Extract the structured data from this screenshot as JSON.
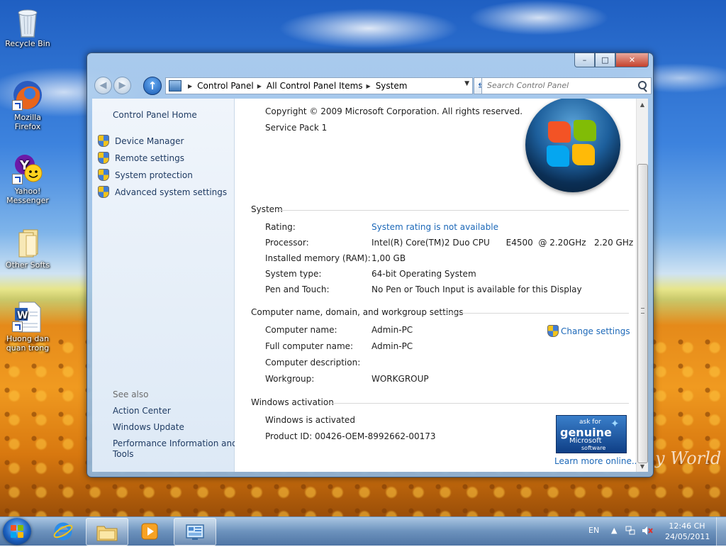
{
  "desktop": {
    "icons": [
      {
        "label": "Recycle Bin",
        "icon": "recycle-bin-icon"
      },
      {
        "label": "Mozilla Firefox",
        "icon": "firefox-icon"
      },
      {
        "label": "Yahoo! Messenger",
        "icon": "yahoo-messenger-icon"
      },
      {
        "label": "Other Softs",
        "icon": "folder-icon"
      },
      {
        "label": "Huong dan quan trong",
        "icon": "word-document-icon"
      }
    ],
    "watermark": "y World"
  },
  "window": {
    "controls": {
      "minimize": "–",
      "maximize": "□",
      "close": "✕"
    },
    "breadcrumbs": [
      "Control Panel",
      "All Control Panel Items",
      "System"
    ],
    "search_placeholder": "Search Control Panel"
  },
  "sidebar": {
    "home": "Control Panel Home",
    "tasks": [
      "Device Manager",
      "Remote settings",
      "System protection",
      "Advanced system settings"
    ],
    "see_also_title": "See also",
    "see_also": [
      "Action Center",
      "Windows Update",
      "Performance Information and",
      "Tools"
    ]
  },
  "content": {
    "copyright": "Copyright © 2009 Microsoft Corporation.  All rights reserved.",
    "service_pack": "Service Pack 1",
    "system": {
      "title": "System",
      "rows": [
        {
          "label": "Rating:",
          "value": "System rating is not available"
        },
        {
          "label": "Processor:",
          "value": "Intel(R) Core(TM)2 Duo CPU      E4500  @ 2.20GHz   2.20 GHz"
        },
        {
          "label": "Installed memory (RAM):",
          "value": "1,00 GB"
        },
        {
          "label": "System type:",
          "value": "64-bit Operating System"
        },
        {
          "label": "Pen and Touch:",
          "value": "No Pen or Touch Input is available for this Display"
        }
      ]
    },
    "computer": {
      "title": "Computer name, domain, and workgroup settings",
      "change_settings": "Change settings",
      "rows": [
        {
          "label": "Computer name:",
          "value": "Admin-PC"
        },
        {
          "label": "Full computer name:",
          "value": "Admin-PC"
        },
        {
          "label": "Computer description:",
          "value": ""
        },
        {
          "label": "Workgroup:",
          "value": "WORKGROUP"
        }
      ]
    },
    "activation": {
      "title": "Windows activation",
      "status": "Windows is activated",
      "product_id": "Product ID: 00426-OEM-8992662-00173",
      "learn_more": "Learn more online...",
      "badge": {
        "ask_for": "ask for",
        "genuine": "genuine",
        "microsoft": "Microsoft",
        "software": "software"
      }
    }
  },
  "taskbar": {
    "language": "EN",
    "time": "12:46 CH",
    "date": "24/05/2011"
  },
  "colors": {
    "link": "#1c68b8",
    "sidebar_link": "#1f3b63",
    "taskbar": "#5e86b5"
  }
}
